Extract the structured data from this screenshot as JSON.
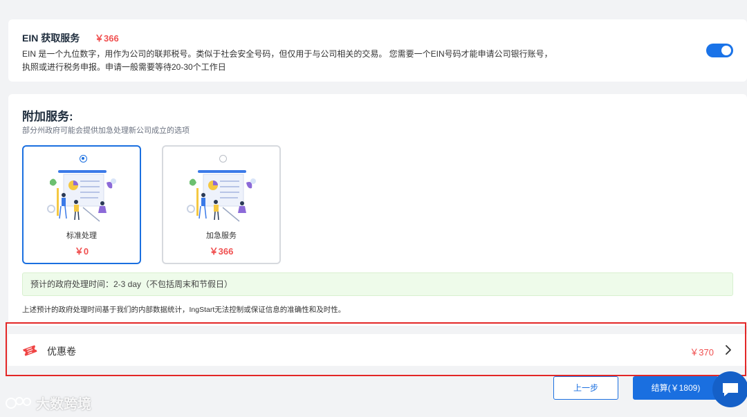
{
  "ein": {
    "title": "EIN 获取服务",
    "price": "￥366",
    "description": "EIN 是一个九位数字，用作为公司的联邦税号。类似于社会安全号码，但仅用于与公司相关的交易。 您需要一个EIN号码才能申请公司银行账号， 执照或进行税务申报。申请一般需要等待20-30个工作日",
    "enabled": true
  },
  "addon": {
    "title": "附加服务:",
    "subtitle": "部分州政府可能会提供加急处理新公司成立的选项",
    "options": [
      {
        "label": "标准处理",
        "price": "￥0",
        "selected": true
      },
      {
        "label": "加急服务",
        "price": "￥366",
        "selected": false
      }
    ],
    "estimate": "预计的政府处理时间：2-3 day（不包括周末和节假日）",
    "disclaimer": "上述预计的政府处理时间基于我们的内部数据统计，IngStart无法控制或保证信息的准确性和及时性。"
  },
  "coupon": {
    "label": "优惠卷",
    "amount": "￥370"
  },
  "actions": {
    "prev_label": "上一步",
    "pay_label": "结算(￥1809)"
  },
  "watermark": {
    "text": "大数跨境"
  },
  "colors": {
    "primary": "#1a6fe0",
    "price": "#f05050",
    "highlight_frame": "#e32626"
  },
  "icons": [
    "toggle-switch",
    "radio",
    "illustration",
    "coupon-ticket-icon",
    "chevron-right-icon",
    "chat-icon"
  ]
}
